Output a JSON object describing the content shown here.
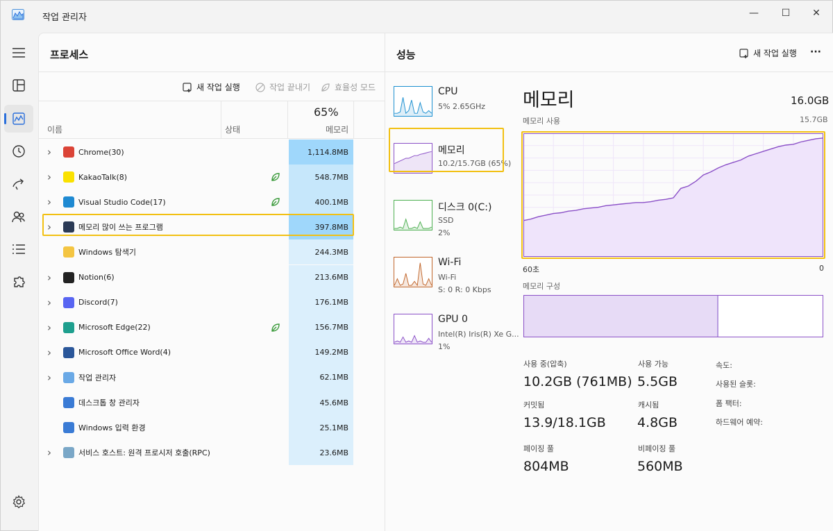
{
  "window": {
    "title": "작업 관리자",
    "min_glyph": "—",
    "max_glyph": "☐",
    "close_glyph": "✕"
  },
  "sidebar": {
    "items": [
      {
        "name": "hamburger-menu-icon"
      },
      {
        "name": "processes-icon"
      },
      {
        "name": "performance-icon",
        "active": true
      },
      {
        "name": "app-history-icon"
      },
      {
        "name": "startup-apps-icon"
      },
      {
        "name": "users-icon"
      },
      {
        "name": "details-icon"
      },
      {
        "name": "services-icon"
      },
      {
        "name": "settings-icon"
      }
    ]
  },
  "processes": {
    "title": "프로세스",
    "toolbar": {
      "run_task": "새 작업 실행",
      "end_task": "작업 끝내기",
      "efficiency": "효율성 모드"
    },
    "columns": {
      "name": "이름",
      "status": "상태",
      "memory_percent": "65%",
      "memory": "메모리"
    },
    "rows": [
      {
        "name": "Chrome(30)",
        "memory": "1,114.8MB",
        "expandable": true,
        "icon": "chrome-icon",
        "color": "#db4437",
        "leaf": false,
        "heat": "h"
      },
      {
        "name": "KakaoTalk(8)",
        "memory": "548.7MB",
        "expandable": true,
        "icon": "kakaotalk-icon",
        "color": "#fae100",
        "leaf": true,
        "heat": "m"
      },
      {
        "name": "Visual Studio Code(17)",
        "memory": "400.1MB",
        "expandable": true,
        "icon": "vscode-icon",
        "color": "#1f8ad2",
        "leaf": true,
        "heat": "m"
      },
      {
        "name": "메모리 많이 쓰는 프로그램",
        "memory": "397.8MB",
        "expandable": true,
        "icon": "app-icon",
        "color": "#2b3a55",
        "leaf": false,
        "heat": "h"
      },
      {
        "name": "Windows 탐색기",
        "memory": "244.3MB",
        "expandable": false,
        "icon": "folder-icon",
        "color": "#f4c542",
        "leaf": false,
        "heat": "l"
      },
      {
        "name": "Notion(6)",
        "memory": "213.6MB",
        "expandable": true,
        "icon": "notion-icon",
        "color": "#222222",
        "leaf": false,
        "heat": "l"
      },
      {
        "name": "Discord(7)",
        "memory": "176.1MB",
        "expandable": true,
        "icon": "discord-icon",
        "color": "#5865f2",
        "leaf": false,
        "heat": "l"
      },
      {
        "name": "Microsoft Edge(22)",
        "memory": "156.7MB",
        "expandable": true,
        "icon": "edge-icon",
        "color": "#1e9f8e",
        "leaf": true,
        "heat": "l"
      },
      {
        "name": "Microsoft Office Word(4)",
        "memory": "149.2MB",
        "expandable": true,
        "icon": "word-icon",
        "color": "#2b579a",
        "leaf": false,
        "heat": "l"
      },
      {
        "name": "작업 관리자",
        "memory": "62.1MB",
        "expandable": true,
        "icon": "task-manager-icon",
        "color": "#6aa9e6",
        "leaf": false,
        "heat": "l"
      },
      {
        "name": "데스크톱 창 관리자",
        "memory": "45.6MB",
        "expandable": false,
        "icon": "dwm-icon",
        "color": "#3a7bd5",
        "leaf": false,
        "heat": "l"
      },
      {
        "name": "Windows 입력 환경",
        "memory": "25.1MB",
        "expandable": false,
        "icon": "input-icon",
        "color": "#3a7bd5",
        "leaf": false,
        "heat": "l"
      },
      {
        "name": "서비스 호스트: 원격 프로시저 호출(RPC)",
        "memory": "23.6MB",
        "expandable": true,
        "icon": "gear-icon",
        "color": "#7aa7c7",
        "leaf": false,
        "heat": "l"
      }
    ]
  },
  "performance": {
    "title": "성능",
    "run_task": "새 작업 실행",
    "more": "···",
    "items": [
      {
        "title": "CPU",
        "sub1": "5%  2.65GHz",
        "sub2": "",
        "color": "#1a8fd0"
      },
      {
        "title": "메모리",
        "sub1": "10.2/15.7GB (65%)",
        "sub2": "",
        "color": "#8a4fc7"
      },
      {
        "title": "디스크 0(C:)",
        "sub1": "SSD",
        "sub2": "2%",
        "color": "#4caf50"
      },
      {
        "title": "Wi-Fi",
        "sub1": "Wi-Fi",
        "sub2": "S: 0 R: 0 Kbps",
        "color": "#c0652a"
      },
      {
        "title": "GPU 0",
        "sub1": "Intel(R) Iris(R) Xe G...",
        "sub2": "1%",
        "color": "#8a4fc7"
      }
    ],
    "memory": {
      "heading": "메모리",
      "total": "16.0GB",
      "usage_label": "메모리 사용",
      "usage_max": "15.7GB",
      "axis_left": "60초",
      "axis_right": "0",
      "composition_label": "메모리 구성",
      "composition_fraction": 0.65,
      "stats": {
        "in_use_label": "사용 중(압축)",
        "in_use": "10.2GB (761MB)",
        "available_label": "사용 가능",
        "available": "5.5GB",
        "committed_label": "커밋됨",
        "committed": "13.9/18.1GB",
        "cached_label": "캐시됨",
        "cached": "4.8GB",
        "paged_label": "페이징 풀",
        "paged": "804MB",
        "nonpaged_label": "비페이징 풀",
        "nonpaged": "560MB",
        "speed_label": "속도:",
        "slots_label": "사용된 슬롯:",
        "form_label": "폼 팩터:",
        "reserved_label": "하드웨어 예약:"
      }
    }
  },
  "chart_data": {
    "type": "area",
    "title": "메모리 사용",
    "xlabel": "",
    "ylabel": "",
    "x_range_label": [
      "60초",
      "0"
    ],
    "ylim": [
      0,
      15.7
    ],
    "series": [
      {
        "values": [
          4.6,
          4.8,
          5.1,
          5.3,
          5.5,
          5.6,
          5.8,
          5.9,
          6.1,
          6.2,
          6.3,
          6.5,
          6.6,
          6.7,
          6.8,
          6.9,
          6.9,
          7.0,
          7.2,
          7.3,
          7.5,
          8.7,
          9.0,
          9.6,
          10.4,
          10.8,
          11.3,
          11.7,
          12.0,
          12.3,
          12.8,
          13.1,
          13.4,
          13.7,
          14.0,
          14.2,
          14.3,
          14.6,
          14.8,
          15.0,
          15.1
        ]
      }
    ]
  }
}
